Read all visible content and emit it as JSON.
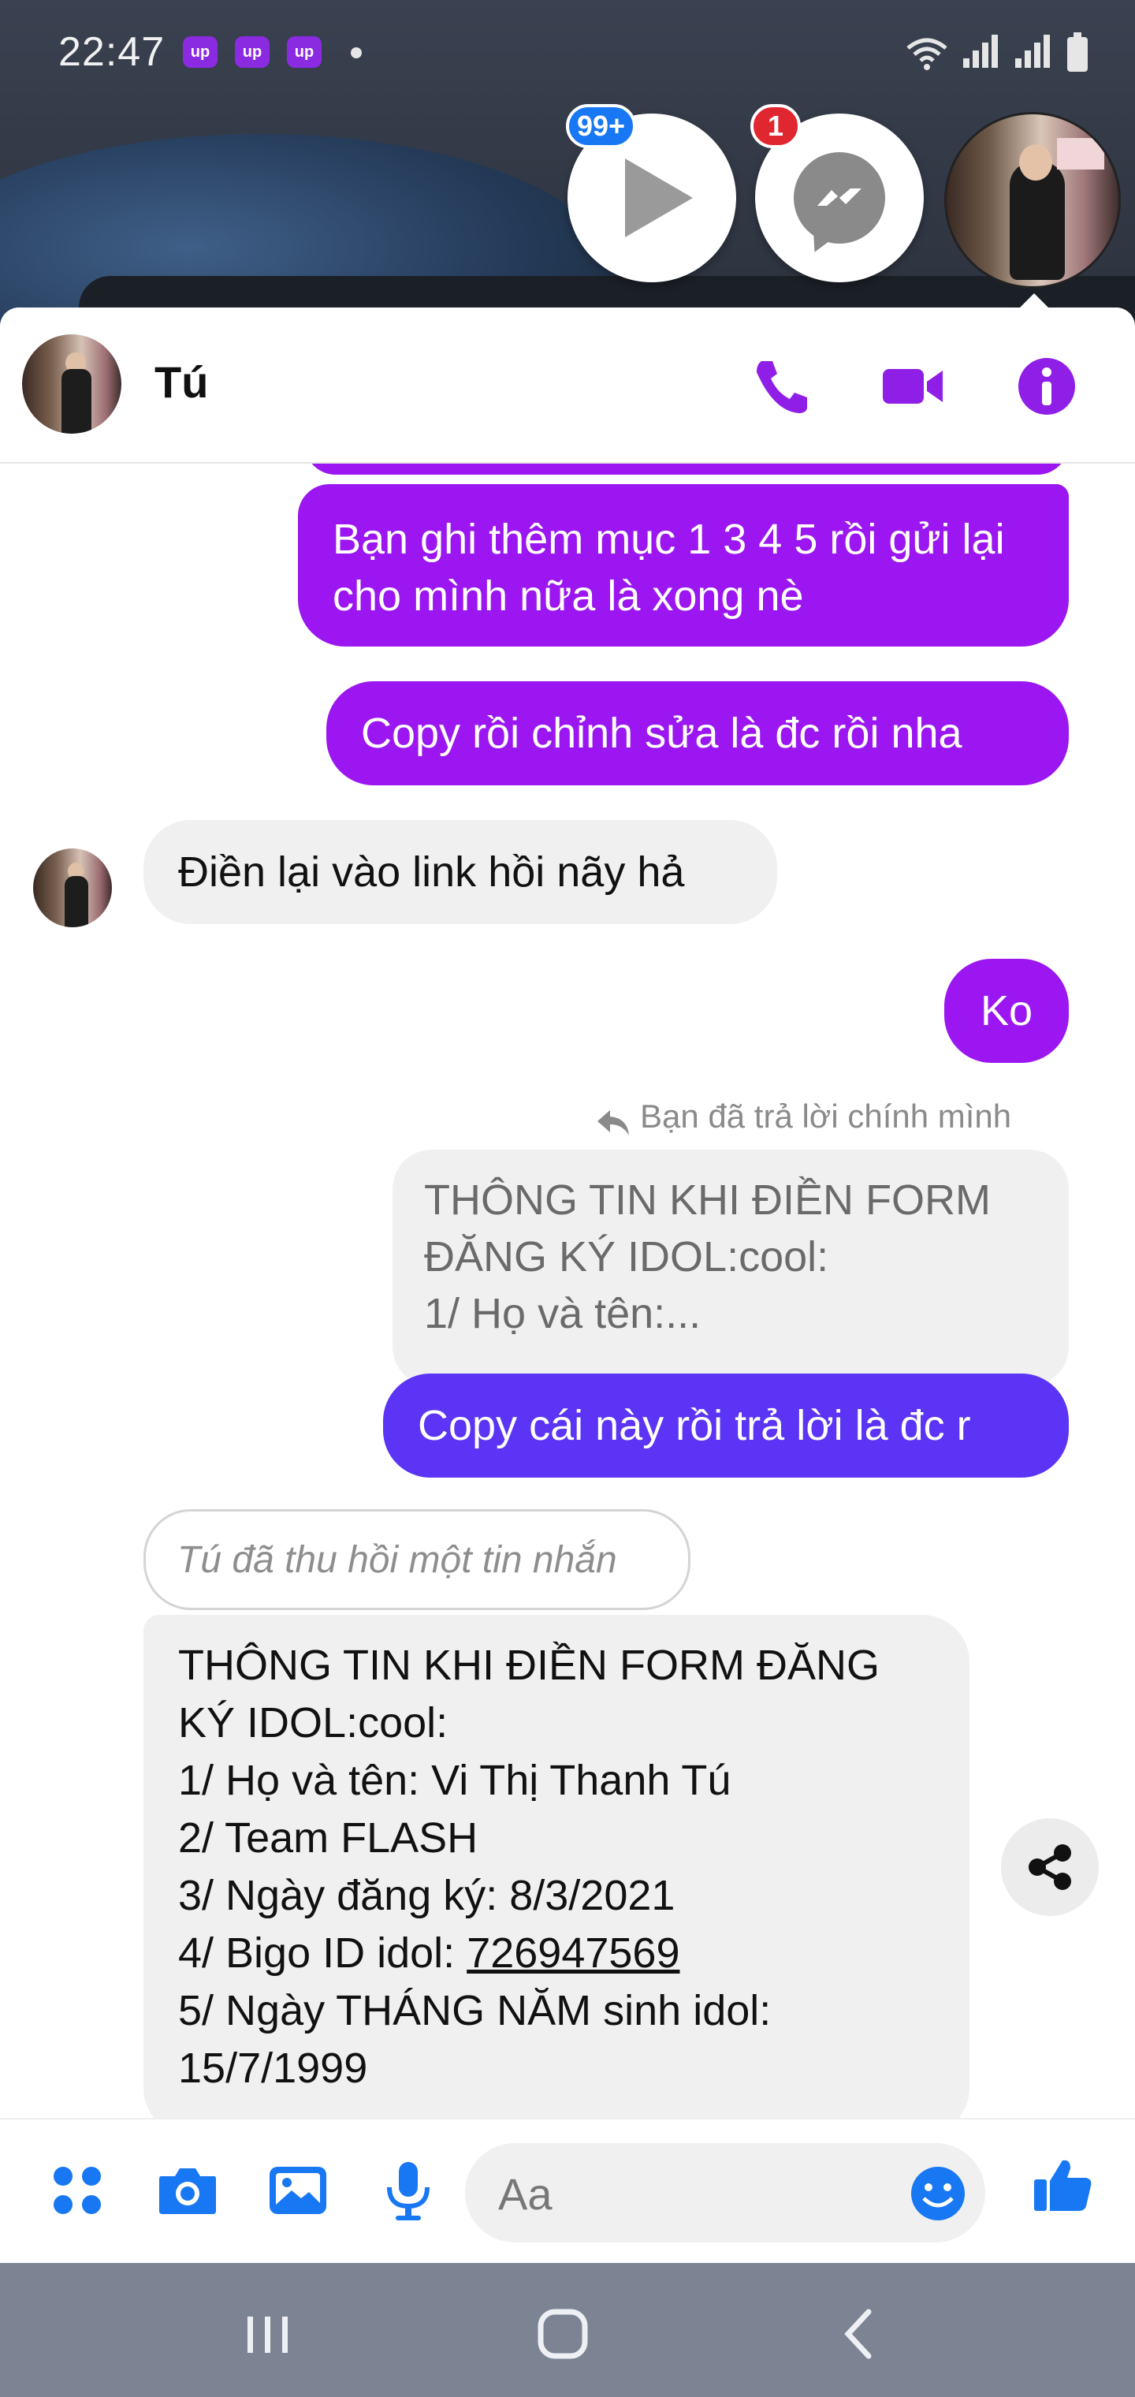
{
  "colors": {
    "accent": "#9b16f0",
    "accent_blue": "#5b34f5",
    "icon_purple": "#8f1ee6",
    "composer_blue": "#1877f2",
    "badge_blue": "#1877f2",
    "badge_red": "#e0262f",
    "bubble_in": "#f0f0f0"
  },
  "status_bar": {
    "time": "22:47",
    "app_icons": [
      "up",
      "up",
      "up"
    ]
  },
  "chat_heads": {
    "video_badge": "99+",
    "messenger_badge": "1"
  },
  "header": {
    "contact_name": "Tú",
    "icons": [
      "phone-icon",
      "video-camera-icon",
      "info-icon"
    ]
  },
  "messages": {
    "m1": "Bạn ghi thêm mục 1 3 4 5 rồi gửi lại cho mình nữa là xong nè",
    "m2": "Copy rồi chỉnh sửa là đc rồi nha",
    "m3": "Điền lại vào link hồi nãy hả",
    "m4": "Ko",
    "reply_note": "Bạn đã trả lời chính mình",
    "quoted_line1": "THÔNG TIN KHI ĐIỀN FORM",
    "quoted_line2": "ĐĂNG KÝ IDOL:cool:",
    "quoted_line3": "1/ Họ và tên:...",
    "m5": "Copy cái này rồi trả lời là đc r",
    "unsent": "Tú đã thu hồi một tin nhắn",
    "form_line1": "THÔNG TIN KHI ĐIỀN FORM ĐĂNG",
    "form_line2": "KÝ IDOL:cool:",
    "form_line3": "1/ Họ và tên: Vi Thị Thanh Tú",
    "form_line4": "2/ Team FLASH",
    "form_line5_prefix": "3/ Ngày đăng ký: 8/3/2021",
    "form_line6_prefix": "4/ Bigo ID idol: ",
    "form_line6_link": "726947569",
    "form_line7": "5/ Ngày THÁNG NĂM sinh idol:",
    "form_line8": "15/7/1999"
  },
  "composer": {
    "placeholder": "Aa",
    "icons": [
      "apps-icon",
      "camera-icon",
      "gallery-icon",
      "microphone-icon",
      "emoji-icon",
      "thumbs-up-icon"
    ]
  },
  "nav": {
    "icons": [
      "recent-apps-icon",
      "home-icon",
      "back-icon"
    ]
  }
}
